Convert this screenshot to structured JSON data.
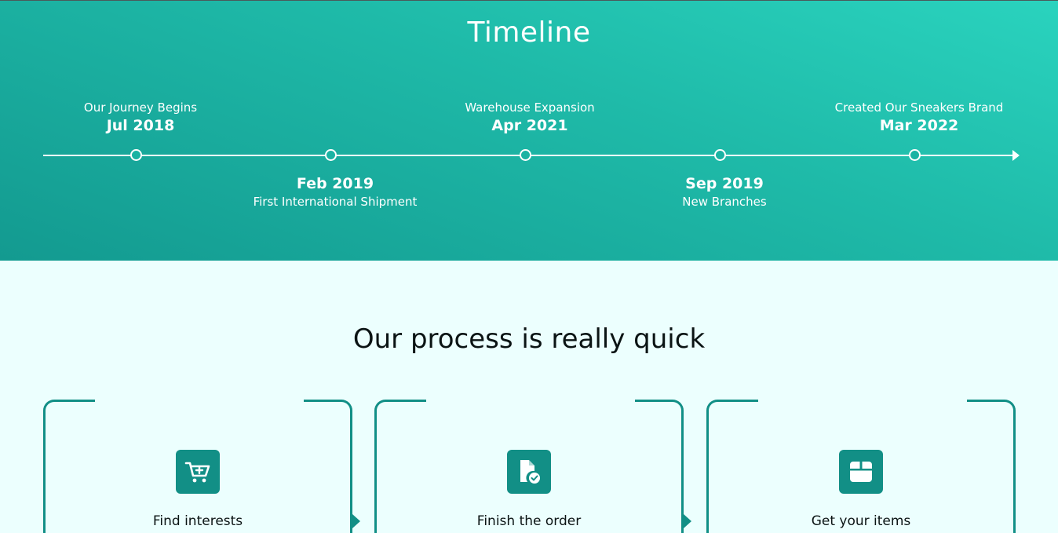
{
  "hero": {
    "title": "Timeline",
    "events": [
      {
        "caption": "Our Journey Begins",
        "date": "Jul 2018"
      },
      {
        "caption": "First International Shipment",
        "date": "Feb 2019"
      },
      {
        "caption": "Warehouse Expansion",
        "date": "Apr 2021"
      },
      {
        "caption": "New Branches",
        "date": "Sep 2019"
      },
      {
        "caption": "Created Our Sneakers Brand",
        "date": "Mar 2022"
      }
    ]
  },
  "process": {
    "title": "Our process is really quick",
    "steps": [
      {
        "label": "Find interests",
        "icon": "cart-plus-icon"
      },
      {
        "label": "Finish the order",
        "icon": "document-check-icon"
      },
      {
        "label": "Get your items",
        "icon": "box-icon"
      }
    ]
  },
  "colors": {
    "accent": "#128f86",
    "hero_gradient_start": "#2ad3be",
    "hero_gradient_end": "#139a90",
    "page_background": "#ecfffe"
  }
}
